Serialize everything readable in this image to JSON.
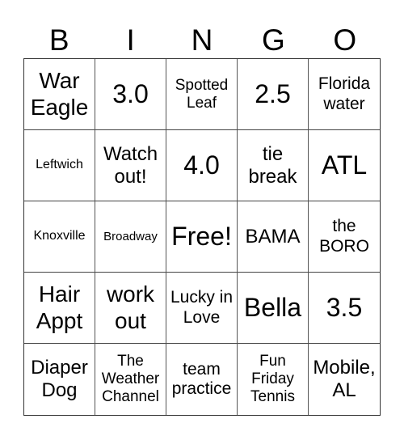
{
  "header": {
    "letters": [
      "B",
      "I",
      "N",
      "G",
      "O"
    ]
  },
  "board": {
    "cells": [
      {
        "text": "War Eagle",
        "size": "l"
      },
      {
        "text": "3.0",
        "size": "xl"
      },
      {
        "text": "Spotted Leaf",
        "size": "s"
      },
      {
        "text": "2.5",
        "size": "xl"
      },
      {
        "text": "Florida water",
        "size": "sm"
      },
      {
        "text": "Leftwich",
        "size": "xs"
      },
      {
        "text": "Watch out!",
        "size": "m"
      },
      {
        "text": "4.0",
        "size": "xl"
      },
      {
        "text": "tie break",
        "size": "m"
      },
      {
        "text": "ATL",
        "size": "xl"
      },
      {
        "text": "Knoxville",
        "size": "xs"
      },
      {
        "text": "Broadway",
        "size": "xxs"
      },
      {
        "text": "Free!",
        "size": "xl"
      },
      {
        "text": "BAMA",
        "size": "m"
      },
      {
        "text": "the BORO",
        "size": "sm"
      },
      {
        "text": "Hair Appt",
        "size": "l"
      },
      {
        "text": "work out",
        "size": "l"
      },
      {
        "text": "Lucky in Love",
        "size": "sm"
      },
      {
        "text": "Bella",
        "size": "xl"
      },
      {
        "text": "3.5",
        "size": "xl"
      },
      {
        "text": "Diaper Dog",
        "size": "m"
      },
      {
        "text": "The Weather Channel",
        "size": "s"
      },
      {
        "text": "team practice",
        "size": "sm"
      },
      {
        "text": "Fun Friday Tennis",
        "size": "s"
      },
      {
        "text": "Mobile, AL",
        "size": "m"
      }
    ]
  }
}
